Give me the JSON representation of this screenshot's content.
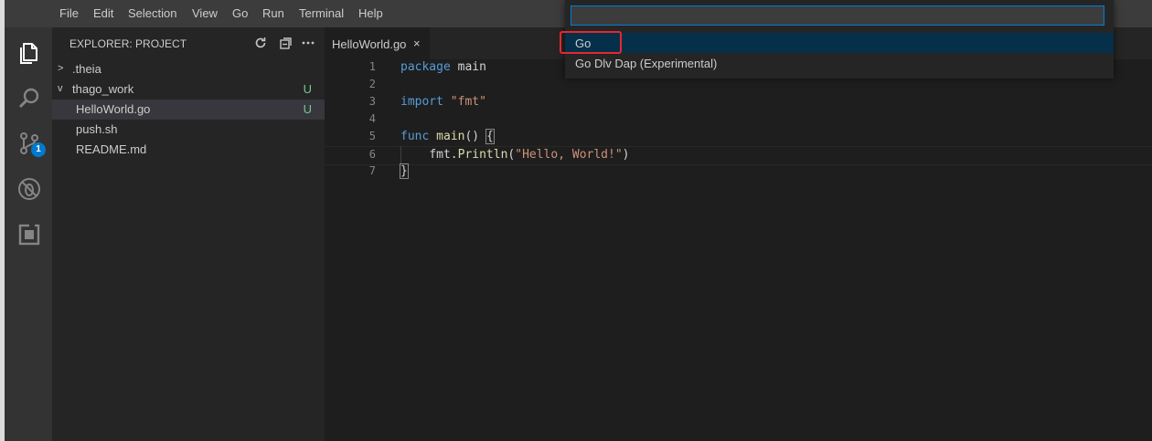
{
  "menubar": {
    "items": [
      "File",
      "Edit",
      "Selection",
      "View",
      "Go",
      "Run",
      "Terminal",
      "Help"
    ]
  },
  "activitybar": {
    "icons": [
      "files-icon",
      "search-icon",
      "source-control-icon",
      "debug-icon",
      "extensions-icon"
    ],
    "scm_badge": "1"
  },
  "sidebar": {
    "title": "EXPLORER: PROJECT",
    "actions": [
      "refresh-icon",
      "collapse-all-icon",
      "more-icon"
    ],
    "tree": [
      {
        "label": ".theia",
        "twisty": ">",
        "status": ""
      },
      {
        "label": "thago_work",
        "twisty": "v",
        "status": "U"
      },
      {
        "label": "HelloWorld.go",
        "twisty": "",
        "status": "U"
      },
      {
        "label": "push.sh",
        "twisty": "",
        "status": ""
      },
      {
        "label": "README.md",
        "twisty": "",
        "status": ""
      }
    ]
  },
  "tabs": [
    {
      "label": "HelloWorld.go",
      "close": "×"
    }
  ],
  "editor": {
    "line_numbers": [
      "1",
      "2",
      "3",
      "4",
      "5",
      "6",
      "7"
    ],
    "lines": {
      "l1": {
        "kw": "package",
        "rest": " main"
      },
      "l3": {
        "kw": "import",
        "str": "\"fmt\""
      },
      "l5": {
        "kw": "func",
        "fn": "main",
        "rest": "() ",
        "brace": "{"
      },
      "l6": {
        "indent": "    ",
        "obj": "fmt.",
        "fn": "Println",
        "open": "(",
        "str": "\"Hello, World!\"",
        "close": ")"
      },
      "l7": {
        "brace": "}"
      }
    }
  },
  "palette": {
    "input_value": "",
    "items": [
      "Go",
      "Go Dlv Dap (Experimental)"
    ]
  },
  "colors": {
    "accent": "#007acc",
    "untracked": "#73c991",
    "highlight_box": "#e8262d",
    "keyword": "#569cd6",
    "string": "#ce9178",
    "function": "#dcdcaa"
  }
}
